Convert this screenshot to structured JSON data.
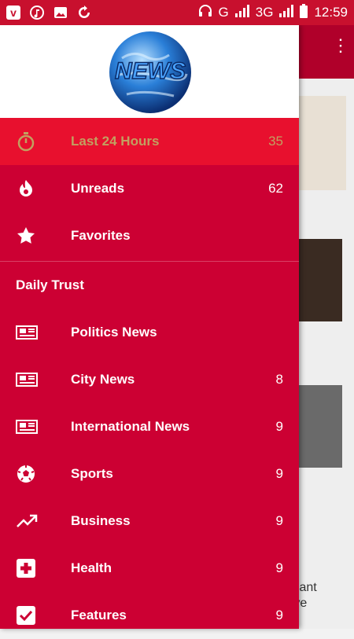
{
  "status_bar": {
    "network": "G",
    "network2": "3G",
    "time": "12:59"
  },
  "drawer": {
    "logo_text": "NEWS",
    "top_items": [
      {
        "label": "Last 24 Hours",
        "count": "35",
        "icon": "stopwatch-icon",
        "active": true
      },
      {
        "label": "Unreads",
        "count": "62",
        "icon": "flame-icon"
      },
      {
        "label": "Favorites",
        "count": "",
        "icon": "star-icon"
      }
    ],
    "section_title": "Daily Trust",
    "feed_items": [
      {
        "label": "Politics News",
        "count": "",
        "icon": "newspaper-icon"
      },
      {
        "label": "City News",
        "count": "8",
        "icon": "newspaper-icon"
      },
      {
        "label": "International News",
        "count": "9",
        "icon": "newspaper-icon"
      },
      {
        "label": "Sports",
        "count": "9",
        "icon": "soccer-ball-icon"
      },
      {
        "label": "Business",
        "count": "9",
        "icon": "trending-up-icon"
      },
      {
        "label": "Health",
        "count": "9",
        "icon": "medical-cross-icon"
      },
      {
        "label": "Features",
        "count": "9",
        "icon": "checkbox-icon"
      }
    ]
  },
  "background": {
    "partial_text_line1": "plant",
    "partial_text_line2": "rve"
  },
  "colors": {
    "drawer_bg": "#cc0033",
    "active_bg": "#e8102e",
    "active_text": "#c2a060",
    "status_bar": "#c8102e"
  }
}
